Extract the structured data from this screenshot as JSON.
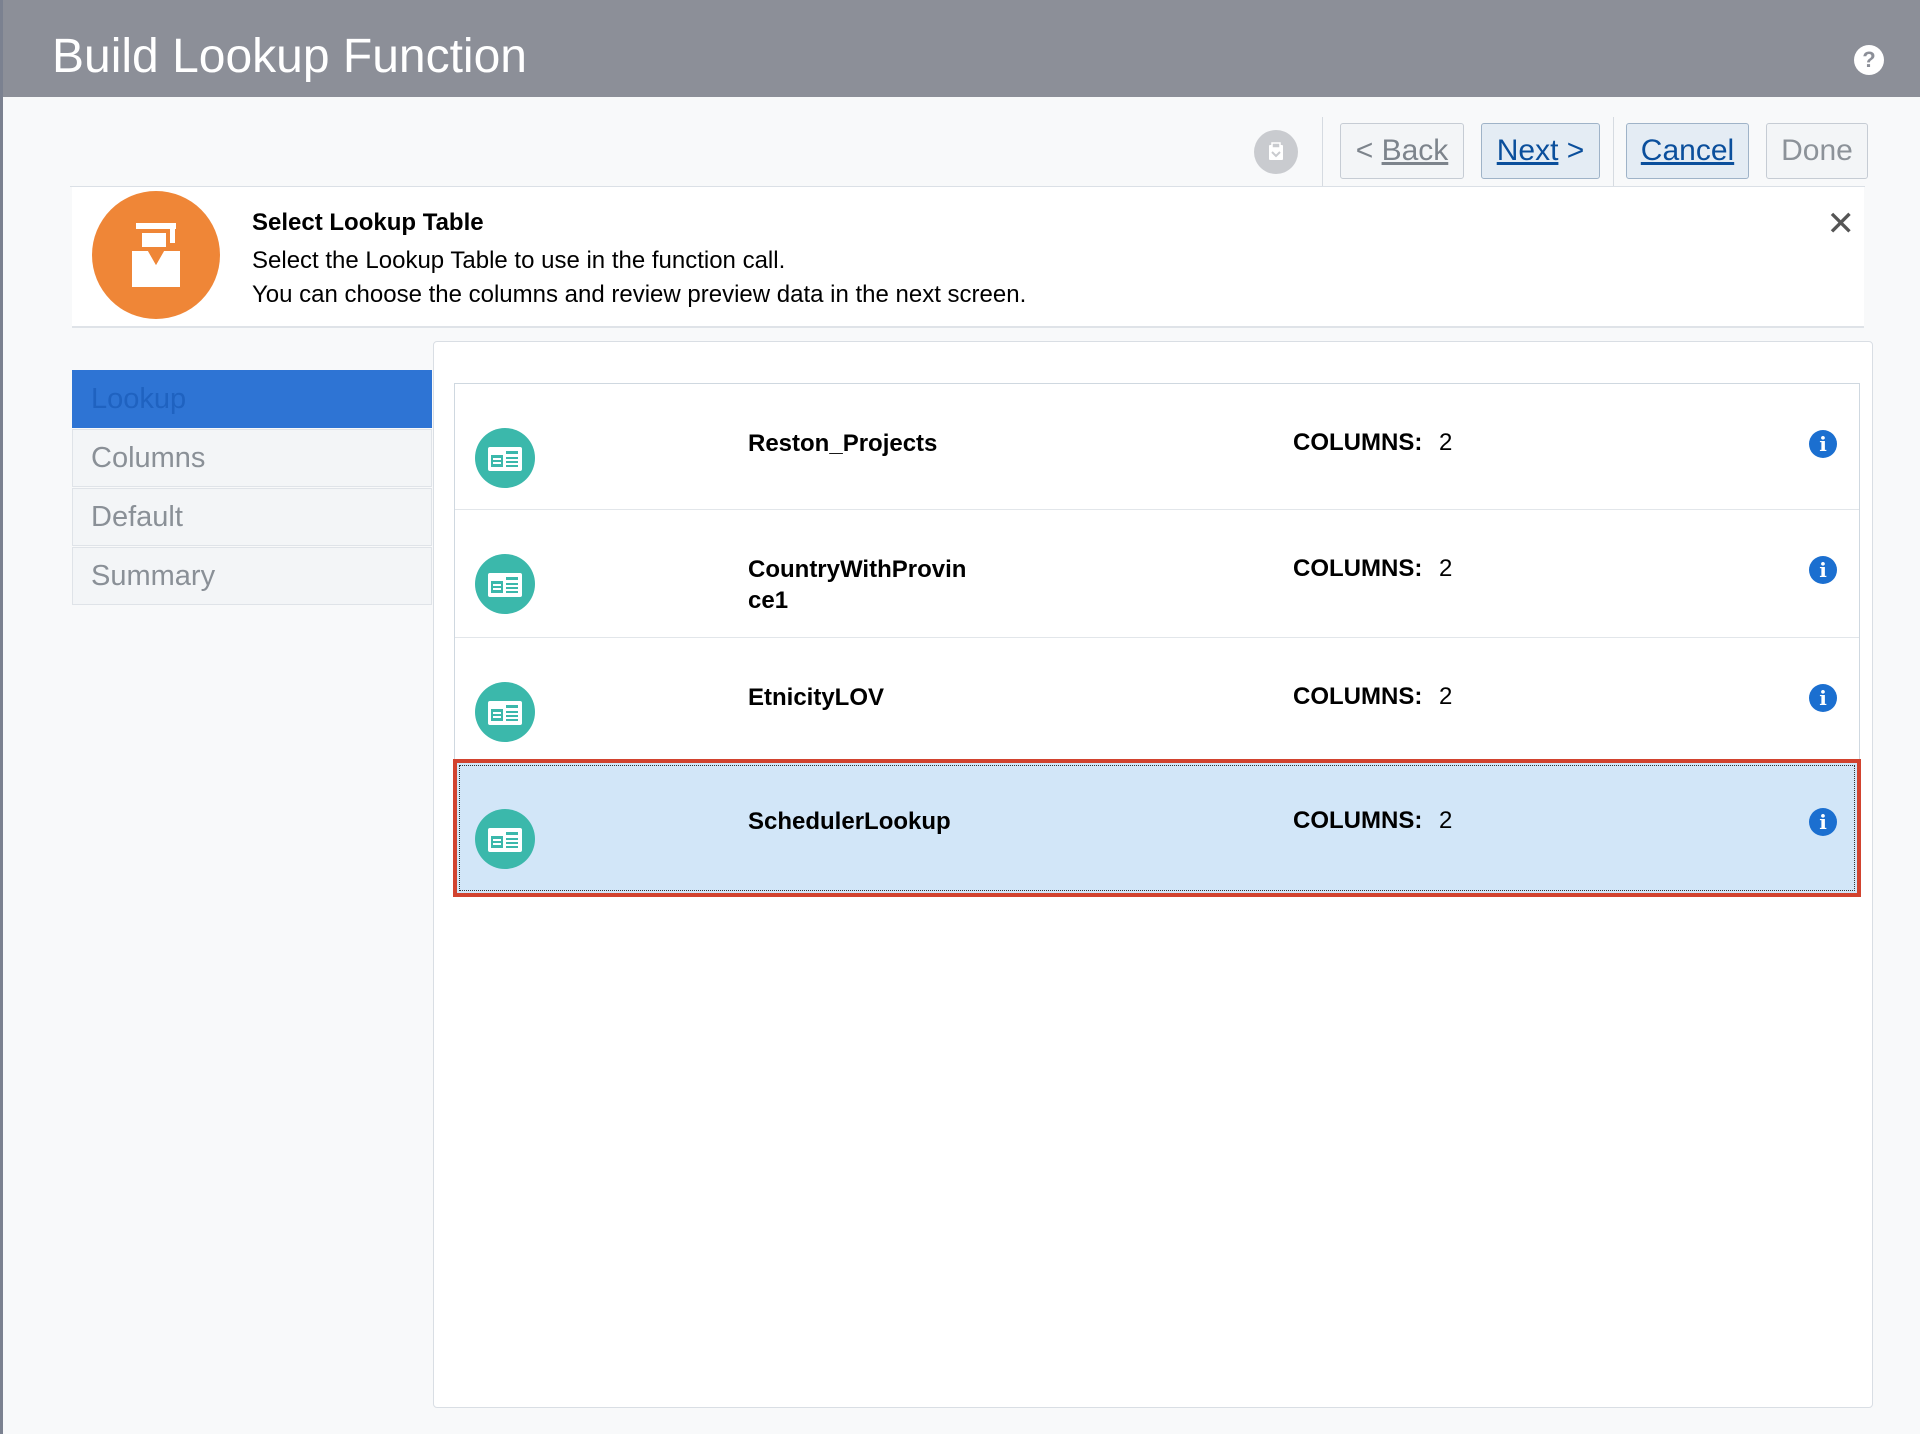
{
  "dialog": {
    "title": "Build Lookup Function",
    "help_icon": "?"
  },
  "toolbar": {
    "back_label_prefix": "< ",
    "back_label": "Back",
    "next_label": "Next",
    "next_label_suffix": " >",
    "cancel_label": "Cancel",
    "done_label": "Done"
  },
  "info": {
    "heading": "Select Lookup Table",
    "line1": "Select the Lookup Table to use in the function call.",
    "line2": "You can choose the columns and review preview data in the next screen.",
    "close_icon": "✕"
  },
  "sidebar": {
    "items": [
      {
        "label": "Lookup",
        "active": true
      },
      {
        "label": "Columns",
        "active": false
      },
      {
        "label": "Default",
        "active": false
      },
      {
        "label": "Summary",
        "active": false
      }
    ]
  },
  "tables": [
    {
      "name": "Reston_Projects",
      "columns_label": "COLUMNS:",
      "columns": "2",
      "selected": false
    },
    {
      "name": "CountryWithProvince1",
      "columns_label": "COLUMNS:",
      "columns": "2",
      "selected": false
    },
    {
      "name": "EtnicityLOV",
      "columns_label": "COLUMNS:",
      "columns": "2",
      "selected": false
    },
    {
      "name": "SchedulerLookup",
      "columns_label": "COLUMNS:",
      "columns": "2",
      "selected": true
    }
  ],
  "colors": {
    "titlebar": "#8c8f98",
    "accent_blue": "#2e74d4",
    "badge_orange": "#ef8637",
    "table_icon_teal": "#3bb8ab",
    "selection_bg": "#d2e6f8",
    "selection_outline": "#d2432f"
  }
}
